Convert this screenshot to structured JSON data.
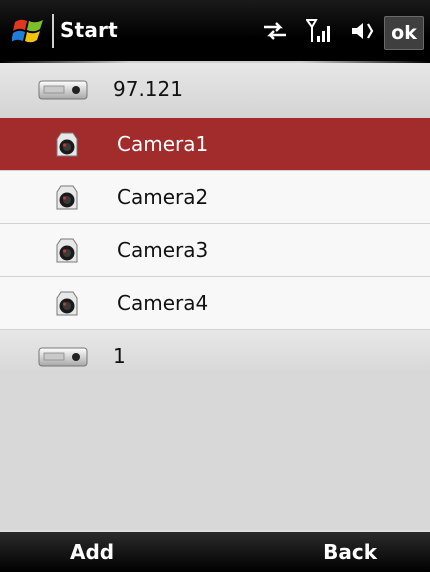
{
  "statusbar": {
    "title": "Start",
    "ok_label": "ok",
    "icons": [
      "windows-start-logo",
      "connectivity-icon",
      "signal-icon",
      "volume-icon"
    ]
  },
  "tree": {
    "devices": [
      {
        "label": "97.121",
        "icon": "dvr-device-icon",
        "cameras": [
          {
            "label": "Camera1",
            "icon": "camera-icon",
            "selected": true
          },
          {
            "label": "Camera2",
            "icon": "camera-icon",
            "selected": false
          },
          {
            "label": "Camera3",
            "icon": "camera-icon",
            "selected": false
          },
          {
            "label": "Camera4",
            "icon": "camera-icon",
            "selected": false
          }
        ]
      },
      {
        "label": "1",
        "icon": "dvr-device-icon",
        "cameras": []
      }
    ]
  },
  "softkeys": {
    "left": "Add",
    "right": "Back"
  },
  "colors": {
    "selected_row": "#a22b2b",
    "topbar": "#000000",
    "device_row": "#dcdcdc"
  }
}
